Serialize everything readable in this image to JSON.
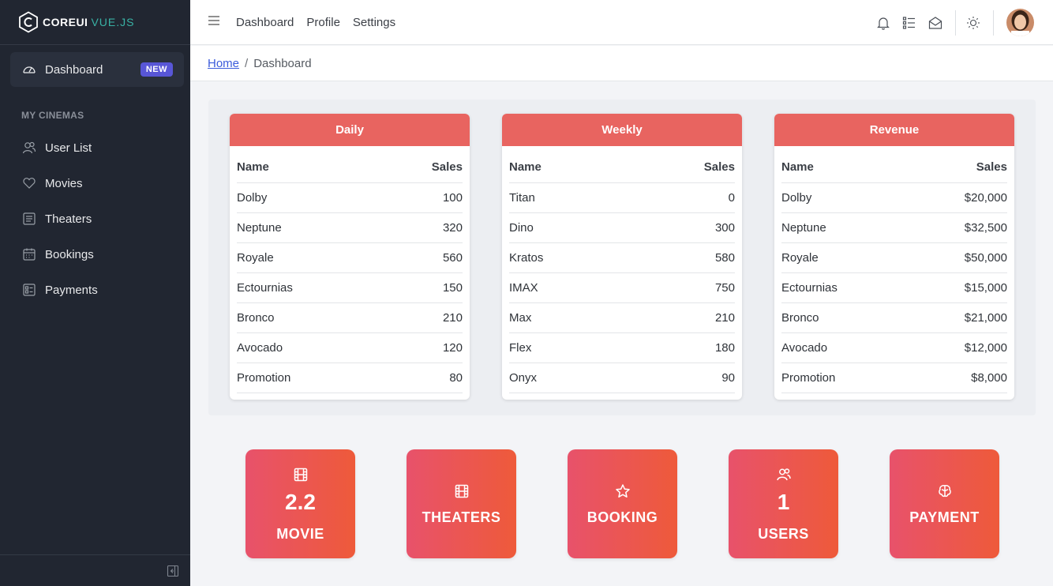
{
  "brand": {
    "part1": "COREUI",
    "part2": "VUE.JS"
  },
  "sidebar": {
    "active": {
      "label": "Dashboard",
      "badge": "NEW"
    },
    "section_title": "MY CINEMAS",
    "items": [
      {
        "label": "User List",
        "icon": "users-icon"
      },
      {
        "label": "Movies",
        "icon": "heart-icon"
      },
      {
        "label": "Theaters",
        "icon": "list-icon"
      },
      {
        "label": "Bookings",
        "icon": "calendar-icon"
      },
      {
        "label": "Payments",
        "icon": "payment-icon"
      }
    ]
  },
  "header": {
    "links": [
      "Dashboard",
      "Profile",
      "Settings"
    ]
  },
  "breadcrumb": {
    "home": "Home",
    "separator": "/",
    "current": "Dashboard"
  },
  "tables": [
    {
      "title": "Daily",
      "columns": [
        "Name",
        "Sales"
      ],
      "rows": [
        [
          "Dolby",
          "100"
        ],
        [
          "Neptune",
          "320"
        ],
        [
          "Royale",
          "560"
        ],
        [
          "Ectournias",
          "150"
        ],
        [
          "Bronco",
          "210"
        ],
        [
          "Avocado",
          "120"
        ],
        [
          "Promotion",
          "80"
        ]
      ]
    },
    {
      "title": "Weekly",
      "columns": [
        "Name",
        "Sales"
      ],
      "rows": [
        [
          "Titan",
          "0"
        ],
        [
          "Dino",
          "300"
        ],
        [
          "Kratos",
          "580"
        ],
        [
          "IMAX",
          "750"
        ],
        [
          "Max",
          "210"
        ],
        [
          "Flex",
          "180"
        ],
        [
          "Onyx",
          "90"
        ]
      ]
    },
    {
      "title": "Revenue",
      "columns": [
        "Name",
        "Sales"
      ],
      "rows": [
        [
          "Dolby",
          "$20,000"
        ],
        [
          "Neptune",
          "$32,500"
        ],
        [
          "Royale",
          "$50,000"
        ],
        [
          "Ectournias",
          "$15,000"
        ],
        [
          "Bronco",
          "$21,000"
        ],
        [
          "Avocado",
          "$12,000"
        ],
        [
          "Promotion",
          "$8,000"
        ]
      ]
    }
  ],
  "tiles": [
    {
      "icon": "film-icon",
      "value": "2.2",
      "label": "MOVIE"
    },
    {
      "icon": "film-icon",
      "value": "",
      "label": "THEATERS"
    },
    {
      "icon": "star-icon",
      "value": "",
      "label": "BOOKING"
    },
    {
      "icon": "users-icon",
      "value": "1",
      "label": "USERS"
    },
    {
      "icon": "brain-icon",
      "value": "",
      "label": "PAYMENT"
    }
  ],
  "colors": {
    "sidebar_bg": "#212631",
    "table_header": "#e86460",
    "tile_gradient_start": "#e8526b",
    "tile_gradient_end": "#ee5a3a",
    "badge": "#5856d6",
    "link": "#3b5bdb"
  }
}
